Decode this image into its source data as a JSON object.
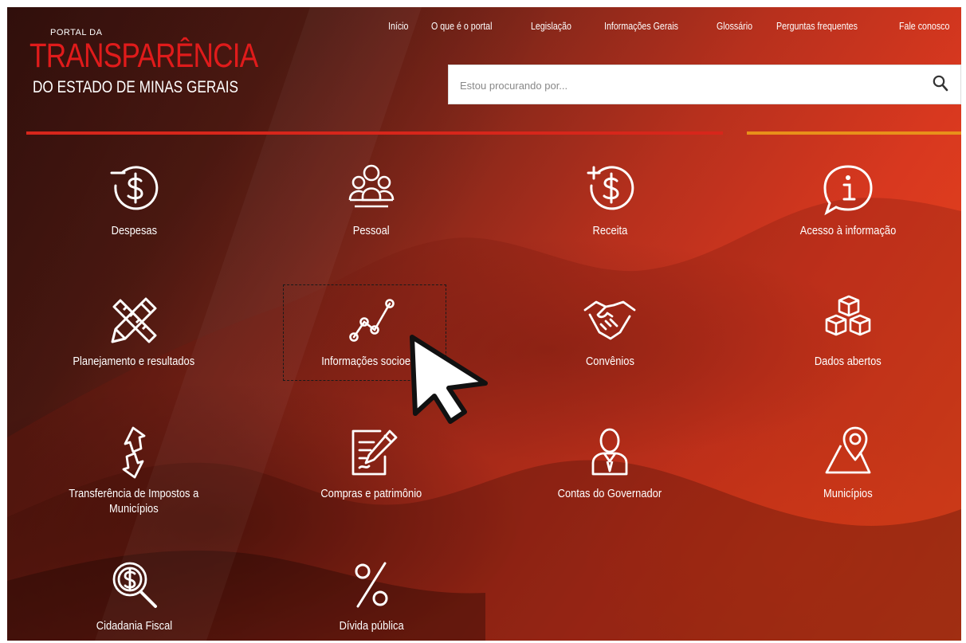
{
  "logo": {
    "small": "PORTAL DA",
    "big": "TRANSPARÊNCIA",
    "sub": "DO ESTADO DE MINAS GERAIS"
  },
  "nav": [
    "Início",
    "O que é o portal",
    "Legislação",
    "Informações Gerais",
    "Glossário",
    "Perguntas frequentes",
    "Fale conosco"
  ],
  "search": {
    "placeholder": "Estou procurando por..."
  },
  "colors": {
    "red_bar": "#d7261b",
    "orange_bar": "#e8901a",
    "logo_red": "#e01b1b"
  },
  "tiles": [
    {
      "label": "Despesas",
      "icon": "money-minus-icon"
    },
    {
      "label": "Pessoal",
      "icon": "people-group-icon"
    },
    {
      "label": "Receita",
      "icon": "money-plus-icon"
    },
    {
      "label": "Acesso à informação",
      "icon": "info-bubble-icon"
    },
    {
      "label": "Planejamento e resultados",
      "icon": "pencil-ruler-icon"
    },
    {
      "label": "Informações socioeco",
      "icon": "line-chart-icon"
    },
    {
      "label": "Convênios",
      "icon": "handshake-icon"
    },
    {
      "label": "Dados abertos",
      "icon": "cubes-icon"
    },
    {
      "label": "Transferência de Impostos a",
      "label2": "Municípios",
      "icon": "transfer-arrows-icon"
    },
    {
      "label": "Compras e patrimônio",
      "icon": "document-pen-icon"
    },
    {
      "label": "Contas do Governador",
      "icon": "person-icon"
    },
    {
      "label": "Municípios",
      "icon": "map-pin-icon"
    },
    {
      "label": "Cidadania Fiscal",
      "icon": "magnifier-coin-icon"
    },
    {
      "label": "Dívida pública",
      "icon": "percent-icon"
    }
  ]
}
